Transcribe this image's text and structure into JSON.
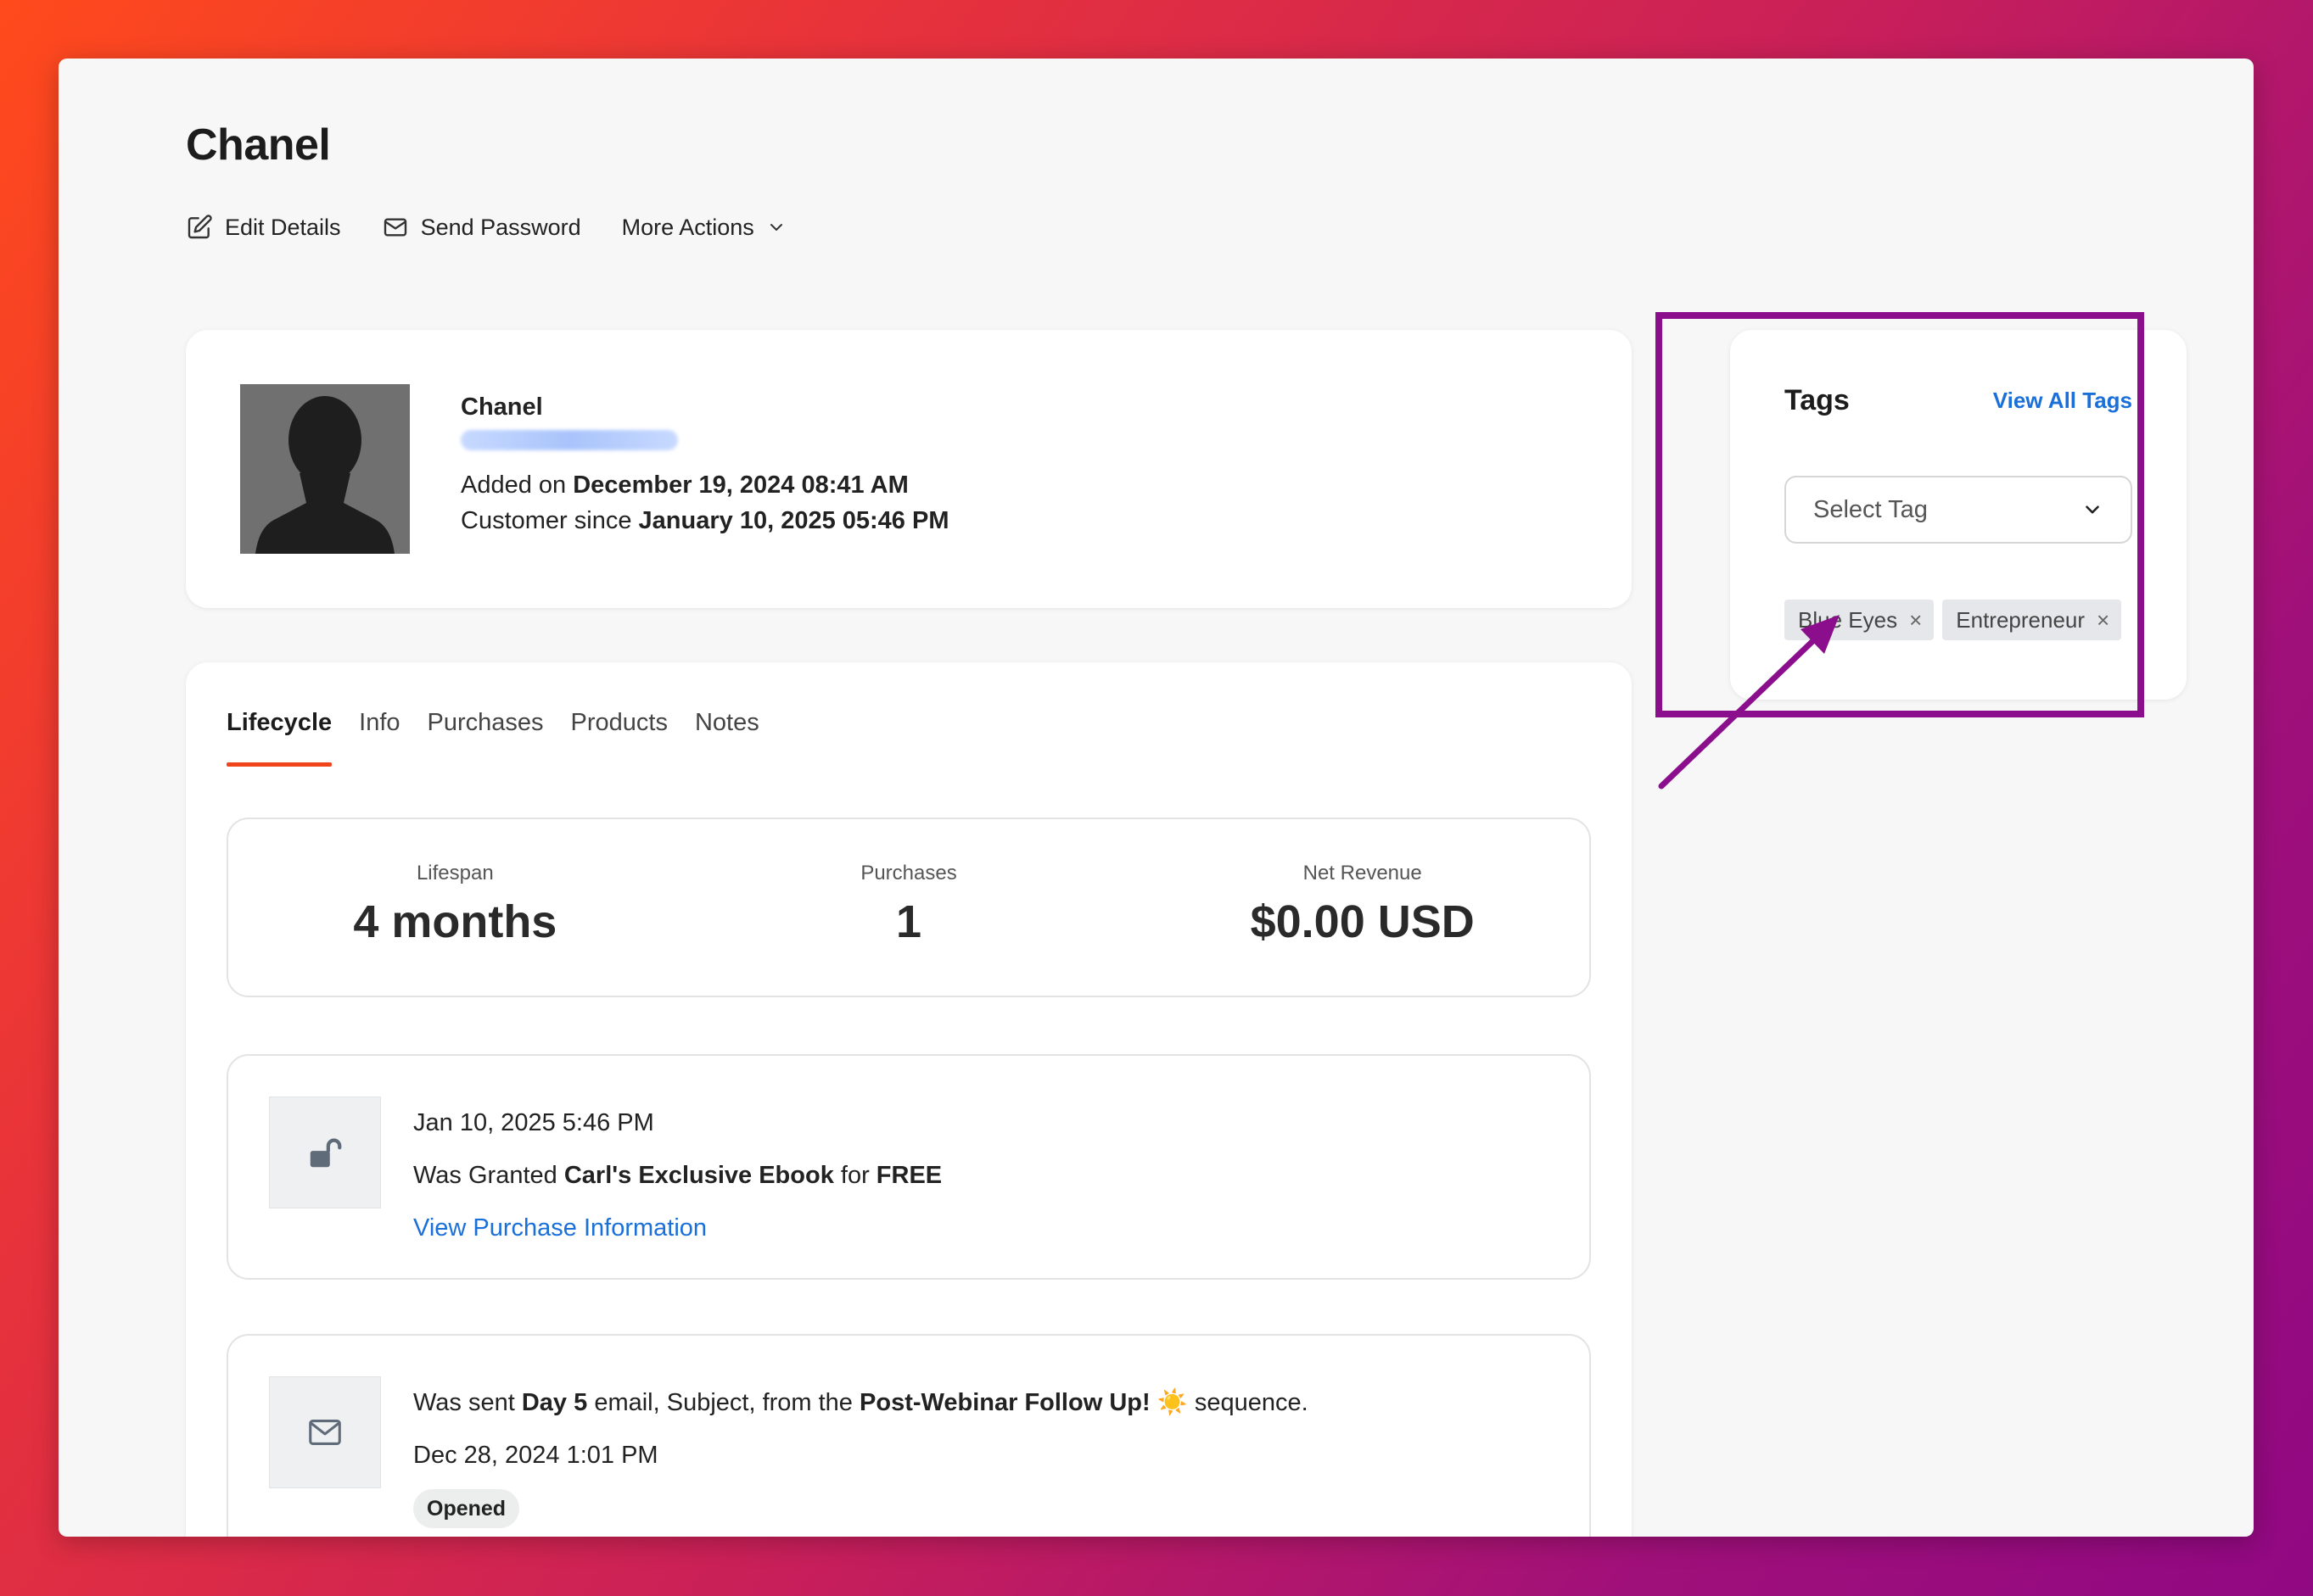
{
  "header": {
    "title": "Chanel",
    "actions": {
      "edit": "Edit Details",
      "send_password": "Send Password",
      "more": "More Actions"
    }
  },
  "profile": {
    "name": "Chanel",
    "added_prefix": "Added on",
    "added_date": "December 19, 2024 08:41 AM",
    "customer_prefix": "Customer since",
    "customer_date": "January 10, 2025 05:46 PM"
  },
  "tabs": [
    "Lifecycle",
    "Info",
    "Purchases",
    "Products",
    "Notes"
  ],
  "active_tab": "Lifecycle",
  "stats": [
    {
      "label": "Lifespan",
      "value": "4 months"
    },
    {
      "label": "Purchases",
      "value": "1"
    },
    {
      "label": "Net Revenue",
      "value": "$0.00 USD"
    }
  ],
  "events": {
    "e1": {
      "date": "Jan 10, 2025 5:46 PM",
      "text_prefix": "Was Granted",
      "product": "Carl's Exclusive Ebook",
      "text_mid": "for",
      "price": "FREE",
      "link": "View Purchase Information"
    },
    "e2": {
      "text_prefix": "Was sent",
      "day": "Day 5",
      "text_mid": "email, Subject, from the",
      "sequence": "Post-Webinar Follow Up! ☀️",
      "text_suffix": "sequence.",
      "date": "Dec 28, 2024 1:01 PM",
      "status": "Opened"
    }
  },
  "tags_panel": {
    "title": "Tags",
    "view_all": "View All Tags",
    "select_placeholder": "Select Tag",
    "tags": [
      "Blue Eyes",
      "Entrepreneur"
    ]
  },
  "colors": {
    "accent_tab": "#f0441a",
    "link": "#1a6fd8",
    "highlight": "#8b0f8c"
  },
  "icons": [
    "edit-icon",
    "mail-icon",
    "chevron-down-icon",
    "unlock-icon",
    "close-icon"
  ]
}
